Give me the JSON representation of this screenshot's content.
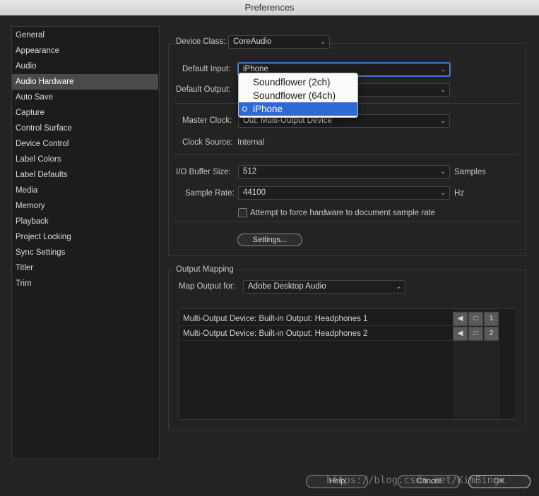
{
  "window": {
    "title": "Preferences"
  },
  "sidebar": {
    "items": [
      {
        "label": "General"
      },
      {
        "label": "Appearance"
      },
      {
        "label": "Audio"
      },
      {
        "label": "Audio Hardware"
      },
      {
        "label": "Auto Save"
      },
      {
        "label": "Capture"
      },
      {
        "label": "Control Surface"
      },
      {
        "label": "Device Control"
      },
      {
        "label": "Label Colors"
      },
      {
        "label": "Label Defaults"
      },
      {
        "label": "Media"
      },
      {
        "label": "Memory"
      },
      {
        "label": "Playback"
      },
      {
        "label": "Project Locking"
      },
      {
        "label": "Sync Settings"
      },
      {
        "label": "Titler"
      },
      {
        "label": "Trim"
      }
    ],
    "selected": "Audio Hardware"
  },
  "hardware": {
    "device_class_label": "Device Class:",
    "device_class_value": "CoreAudio",
    "default_input_label": "Default Input:",
    "default_input_value": "iPhone",
    "default_output_label": "Default Output:",
    "master_clock_label": "Master Clock:",
    "master_clock_value": "Out: Multi-Output Device",
    "clock_source_label": "Clock Source:",
    "clock_source_value": "Internal",
    "io_buffer_label": "I/O Buffer Size:",
    "io_buffer_value": "512",
    "io_buffer_unit": "Samples",
    "sample_rate_label": "Sample Rate:",
    "sample_rate_value": "44100",
    "sample_rate_unit": "Hz",
    "force_rate_label": "Attempt to force hardware to document sample rate",
    "force_rate_checked": false,
    "settings_button": "Settings..."
  },
  "input_dropdown": {
    "options": [
      {
        "label": "Soundflower (2ch)"
      },
      {
        "label": "Soundflower (64ch)"
      },
      {
        "label": "iPhone"
      }
    ],
    "highlighted": "iPhone"
  },
  "output_mapping": {
    "title": "Output Mapping",
    "map_output_label": "Map Output for:",
    "map_output_value": "Adobe Desktop Audio",
    "rows": [
      {
        "label": "Multi-Output Device: Built-in Output: Headphones 1",
        "channel": "1"
      },
      {
        "label": "Multi-Output Device: Built-in Output: Headphones 2",
        "channel": "2"
      }
    ]
  },
  "footer": {
    "help_button": "Help",
    "cancel_button": "Cancel",
    "ok_button": "OK",
    "watermark": "https://blog.csdn.net/KimBing"
  },
  "colors": {
    "accent": "#2f69d3",
    "background": "#232323"
  }
}
